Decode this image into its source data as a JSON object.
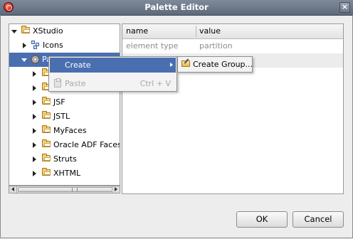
{
  "window": {
    "title": "Palette Editor"
  },
  "tree": {
    "items": [
      {
        "label": "XStudio",
        "expanded": true,
        "icon": "folder-icon"
      },
      {
        "label": "Icons",
        "expanded": false,
        "icon": "icons-icon"
      },
      {
        "label": "Palette",
        "expanded": true,
        "icon": "gears-icon",
        "selected": true
      },
      {
        "label": "",
        "expanded": false,
        "icon": "folder-icon"
      },
      {
        "label": "",
        "expanded": false,
        "icon": "folder-icon"
      },
      {
        "label": "JSF",
        "expanded": false,
        "icon": "folder-icon"
      },
      {
        "label": "JSTL",
        "expanded": false,
        "icon": "folder-icon"
      },
      {
        "label": "MyFaces",
        "expanded": false,
        "icon": "folder-icon"
      },
      {
        "label": "Oracle ADF Faces",
        "expanded": false,
        "icon": "folder-icon"
      },
      {
        "label": "Struts",
        "expanded": false,
        "icon": "folder-icon"
      },
      {
        "label": "XHTML",
        "expanded": false,
        "icon": "folder-icon"
      }
    ],
    "scrollbar_grip": "|||"
  },
  "properties": {
    "columns": [
      "name",
      "value"
    ],
    "rows": [
      {
        "name": "element type",
        "value": "partition"
      }
    ]
  },
  "context_menu": {
    "items": [
      {
        "label": "Create",
        "shortcut": "",
        "enabled": true,
        "submenu": true
      },
      {
        "label": "Paste",
        "shortcut": "Ctrl + V",
        "enabled": false,
        "submenu": false
      }
    ],
    "submenu_items": [
      {
        "label": "Create Group..."
      }
    ]
  },
  "buttons": {
    "ok": "OK",
    "cancel": "Cancel"
  },
  "colors": {
    "selection": "#4a6fb1",
    "titlebar": "#6b7687"
  }
}
